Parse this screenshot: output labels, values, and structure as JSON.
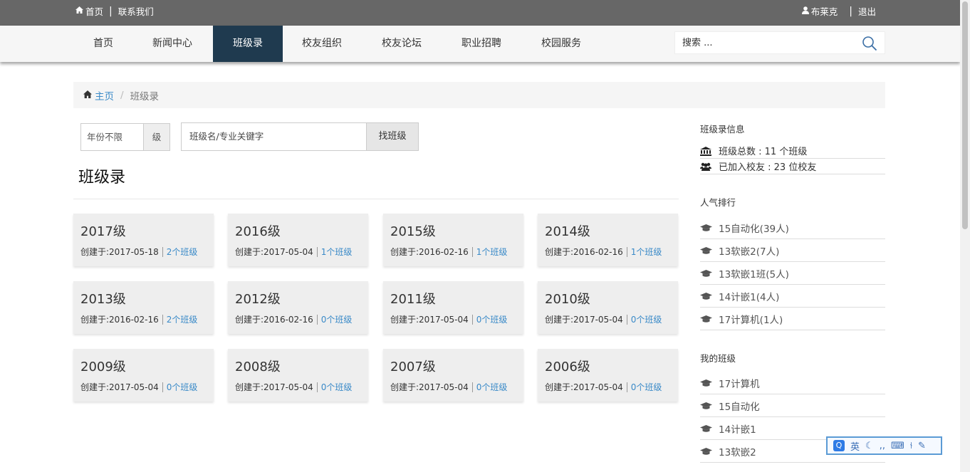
{
  "topbar": {
    "home": "首页",
    "contact": "联系我们",
    "user": "布莱克",
    "logout": "退出"
  },
  "nav": {
    "items": [
      "首页",
      "新闻中心",
      "班级录",
      "校友组织",
      "校友论坛",
      "职业招聘",
      "校园服务"
    ],
    "active": "班级录",
    "search_placeholder": "搜索 ..."
  },
  "breadcrumb": {
    "home": "主页",
    "current": "班级录"
  },
  "filters": {
    "year": "年份不限",
    "year_suffix": "级",
    "keyword_placeholder": "班级名/专业关键字",
    "find_button": "找班级"
  },
  "page_title": "班级录",
  "cards": [
    {
      "year": "2017级",
      "created": "创建于:2017-05-18",
      "count": "2个班级"
    },
    {
      "year": "2016级",
      "created": "创建于:2017-05-04",
      "count": "1个班级"
    },
    {
      "year": "2015级",
      "created": "创建于:2016-02-16",
      "count": "1个班级"
    },
    {
      "year": "2014级",
      "created": "创建于:2016-02-16",
      "count": "1个班级"
    },
    {
      "year": "2013级",
      "created": "创建于:2016-02-16",
      "count": "2个班级"
    },
    {
      "year": "2012级",
      "created": "创建于:2016-02-16",
      "count": "0个班级"
    },
    {
      "year": "2011级",
      "created": "创建于:2017-05-04",
      "count": "0个班级"
    },
    {
      "year": "2010级",
      "created": "创建于:2017-05-04",
      "count": "0个班级"
    },
    {
      "year": "2009级",
      "created": "创建于:2017-05-04",
      "count": "0个班级"
    },
    {
      "year": "2008级",
      "created": "创建于:2017-05-04",
      "count": "0个班级"
    },
    {
      "year": "2007级",
      "created": "创建于:2017-05-04",
      "count": "0个班级"
    },
    {
      "year": "2006级",
      "created": "创建于:2017-05-04",
      "count": "0个班级"
    }
  ],
  "sidebar": {
    "info_title": "班级录信息",
    "total": "班级总数 : 11 个班级",
    "alumni": "已加入校友 : 23 位校友",
    "rank_title": "人气排行",
    "rank": [
      "15自动化(39人)",
      "13软嵌2(7人)",
      "13软嵌1班(5人)",
      "14计嵌1(4人)",
      "17计算机(1人)"
    ],
    "my_title": "我的班级",
    "my": [
      "17计算机",
      "15自动化",
      "14计嵌1",
      "13软嵌2"
    ]
  },
  "ime": {
    "logo": "Q",
    "mode": "英"
  },
  "colors": {
    "topbar": "#676767",
    "nav_active": "#1f3a4f",
    "link": "#3a8ac8",
    "card_bg": "#eeeeee"
  }
}
